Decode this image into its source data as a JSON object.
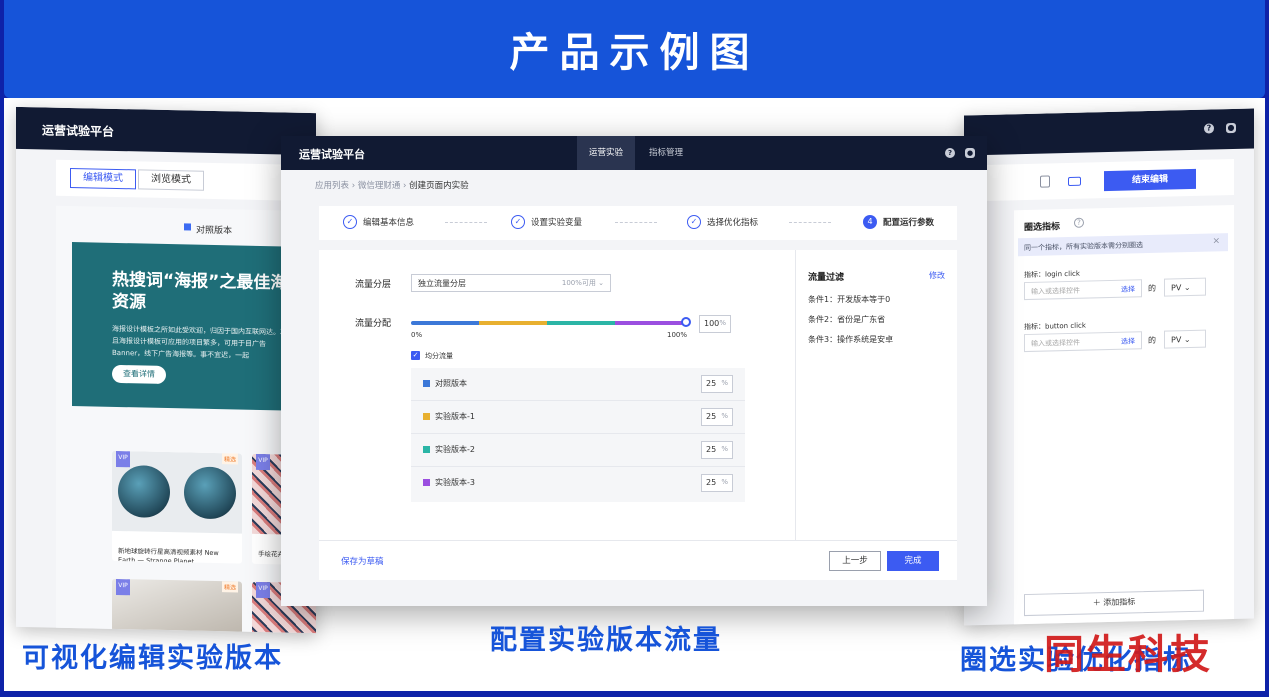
{
  "banner": {
    "title": "产品示例图"
  },
  "left_panel": {
    "brand": "运营试验平台",
    "mode_edit": "编辑模式",
    "mode_browse": "浏览模式",
    "control_label": "对照版本",
    "hero_title": "热搜词“海报”之最佳海资源",
    "hero_desc": "海报设计模板之所如此受欢迎，归因于国内互联网达。况且海报设计模板可应用的项目繁多，可用于目广告Banner，线下广告海报等。事不宜迟，一起",
    "hero_button": "查看详情",
    "card1_tag": "精选",
    "card1_text": "新地球旋转行星高清视频素材 New Earth — Strange Planet",
    "card2_text": "手绘花卉",
    "card3_tag": "精选",
    "vip": "VIP"
  },
  "right_panel": {
    "end_edit": "结束编辑",
    "title": "圈选指标",
    "notice": "同一个指标，所有实验版本需分别圈选",
    "close": "×",
    "metric_prefix": "指标：",
    "metrics": [
      {
        "label": "指标：login click",
        "placeholder": "输入或选择控件",
        "select": "选择",
        "de": "的",
        "pv": "PV ⌄"
      },
      {
        "label": "指标：button click",
        "placeholder": "输入或选择控件",
        "select": "选择",
        "de": "的",
        "pv": "PV ⌄"
      }
    ],
    "add_metric": "＋ 添加指标"
  },
  "center": {
    "brand": "运营试验平台",
    "tabs": [
      "运营实验",
      "指标管理"
    ],
    "breadcrumb": [
      "应用列表",
      "微信理财通",
      "创建页面内实验"
    ],
    "steps": [
      "编辑基本信息",
      "设置实验变量",
      "选择优化指标",
      "配置运行参数"
    ],
    "step4_num": "4",
    "layer_label": "流量分层",
    "layer_value": "独立流量分层",
    "layer_avail": "100%可用 ⌄",
    "alloc_label": "流量分配",
    "tick_min": "0%",
    "tick_max": "100%",
    "total_value": "100",
    "pct": "%",
    "even_label": "均分流量",
    "versions": [
      {
        "name": "对照版本",
        "value": "25",
        "color": "#3c78d8"
      },
      {
        "name": "实验版本-1",
        "value": "25",
        "color": "#e8b030"
      },
      {
        "name": "实验版本-2",
        "value": "25",
        "color": "#2bb5a6"
      },
      {
        "name": "实验版本-3",
        "value": "25",
        "color": "#9b4fe0"
      }
    ],
    "filter_title": "流量过滤",
    "filter_edit": "修改",
    "conditions": [
      "条件1：开发版本等于0",
      "条件2：省份是广东省",
      "条件3：操作系统是安卓"
    ],
    "save_draft": "保存为草稿",
    "prev": "上一步",
    "done": "完成"
  },
  "captions": {
    "left": "可视化编辑实验版本",
    "center": "配置实验版本流量",
    "right": "圈选实验优化指标",
    "watermark": "同生科技"
  }
}
